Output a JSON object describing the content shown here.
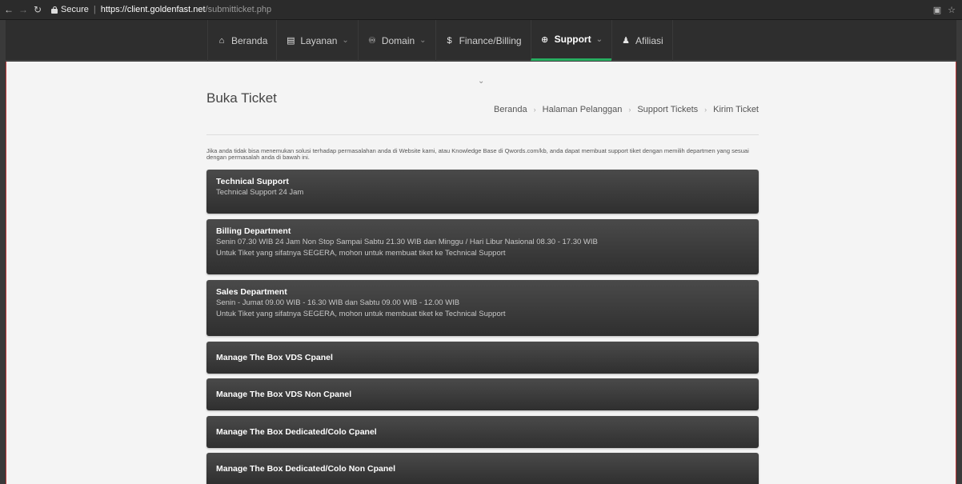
{
  "browser": {
    "secure_label": "Secure",
    "url_host": "https://client.goldenfast.net",
    "url_path": "/submitticket.php"
  },
  "nav": {
    "items": [
      {
        "label": "Beranda",
        "icon": "home-icon",
        "glyph": "⌂",
        "has_caret": false
      },
      {
        "label": "Layanan",
        "icon": "list-icon",
        "glyph": "▤",
        "has_caret": true
      },
      {
        "label": "Domain",
        "icon": "binoculars-icon",
        "glyph": "♾",
        "has_caret": true
      },
      {
        "label": "Finance/Billing",
        "icon": "dollar-icon",
        "glyph": "$",
        "has_caret": false
      },
      {
        "label": "Support",
        "icon": "lifebuoy-icon",
        "glyph": "⊕",
        "has_caret": true
      },
      {
        "label": "Afiliasi",
        "icon": "user-icon",
        "glyph": "♟",
        "has_caret": false
      }
    ],
    "active_index": 4,
    "accent_color": "#27ae60"
  },
  "page": {
    "title": "Buka Ticket",
    "breadcrumb": [
      "Beranda",
      "Halaman Pelanggan",
      "Support Tickets",
      "Kirim Ticket"
    ],
    "intro": "Jika anda tidak bisa menemukan solusi terhadap permasalahan anda di Website kami, atau Knowledge Base di Qwords.com/kb, anda dapat membuat support tiket dengan memilih departmen yang sesuai dengan permasalah anda di bawah ini."
  },
  "departments": [
    {
      "name": "Technical Support",
      "lines": [
        "Technical Support 24 Jam"
      ]
    },
    {
      "name": "Billing Department",
      "lines": [
        "Senin 07.30 WIB 24 Jam Non Stop Sampai Sabtu 21.30 WIB dan Minggu / Hari Libur Nasional 08.30 - 17.30 WIB",
        "Untuk Tiket yang sifatnya SEGERA, mohon untuk membuat tiket ke Technical Support"
      ]
    },
    {
      "name": "Sales Department",
      "lines": [
        "Senin - Jumat 09.00 WIB - 16.30 WIB dan Sabtu 09.00 WIB - 12.00 WIB",
        "Untuk Tiket yang sifatnya SEGERA, mohon untuk membuat tiket ke Technical Support"
      ]
    },
    {
      "name": "Manage The Box VDS Cpanel",
      "lines": []
    },
    {
      "name": "Manage The Box VDS Non Cpanel",
      "lines": []
    },
    {
      "name": "Manage The Box Dedicated/Colo Cpanel",
      "lines": []
    },
    {
      "name": "Manage The Box Dedicated/Colo Non Cpanel",
      "lines": []
    }
  ]
}
